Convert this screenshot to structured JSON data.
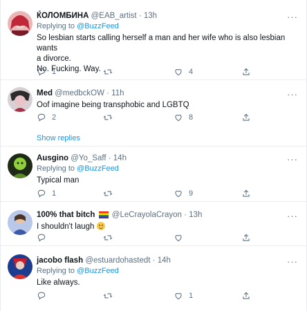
{
  "tweets": [
    {
      "name": "ЌОЛОМБИНА",
      "handle": "@EAB_artist",
      "time": "· 13h",
      "reply_prefix": "Replying to",
      "reply_to": "@BuzzFeed",
      "text1": "So lesbian starts calling herself a man and her wife who is also lesbian wants",
      "text2": "a divorce.",
      "text3": "No. Fucking. Way.",
      "replies": "1",
      "retweets": "",
      "likes": "4"
    },
    {
      "name": "Med",
      "handle": "@medbckOW",
      "time": "· 11h",
      "text1": "Oof imagine being transphobic and LGBTQ",
      "replies": "2",
      "retweets": "",
      "likes": "8",
      "show_replies": "Show replies"
    },
    {
      "name": "Ausgino",
      "handle": "@Yo_Saff",
      "time": "· 14h",
      "reply_prefix": "Replying to",
      "reply_to": "@BuzzFeed",
      "text1": "Typical man",
      "replies": "1",
      "retweets": "",
      "likes": "9"
    },
    {
      "name": "100% that bitch",
      "handle": "@LeCrayolaCrayon",
      "time": "· 13h",
      "text1": "I shouldn't laugh",
      "replies": "",
      "retweets": "",
      "likes": ""
    },
    {
      "name": "jacobo flash",
      "handle": "@estuardohastedt",
      "time": "· 14h",
      "reply_prefix": "Replying to",
      "reply_to": "@BuzzFeed",
      "text1": "Like always.",
      "replies": "",
      "retweets": "",
      "likes": "1"
    }
  ],
  "colors": {
    "link": "#1b95e0",
    "muted": "#5b7083",
    "divider": "#e6ecf0"
  },
  "icons": [
    "reply-icon",
    "retweet-icon",
    "like-icon",
    "share-icon",
    "more-icon"
  ]
}
